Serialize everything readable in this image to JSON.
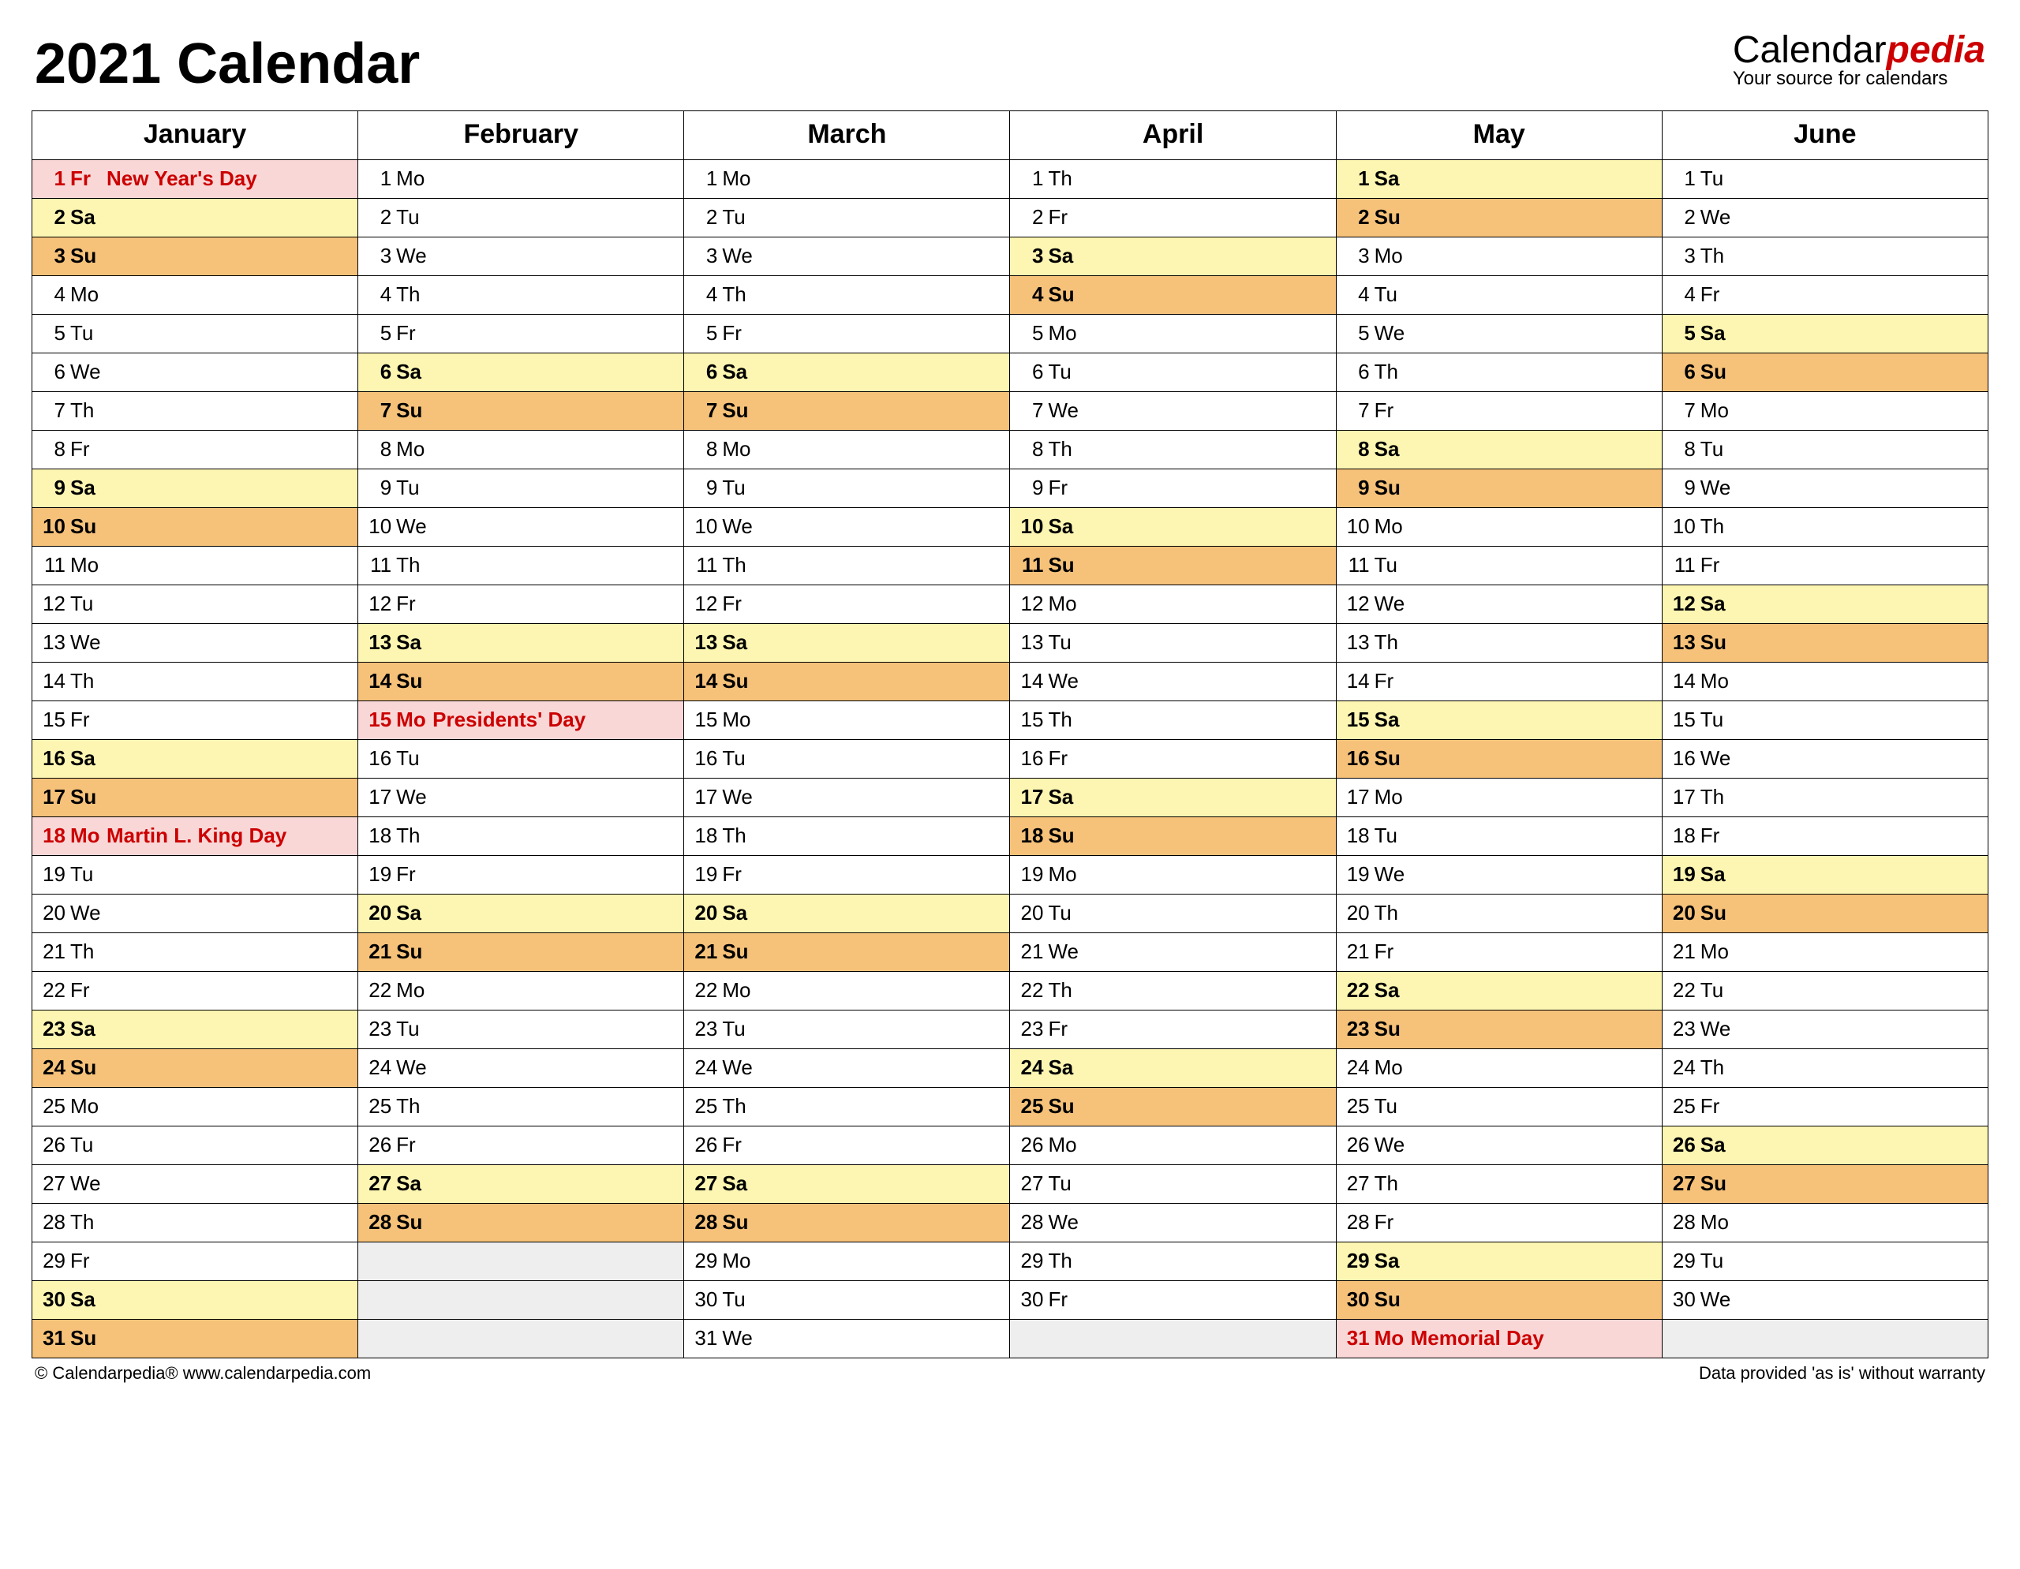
{
  "title": "2021 Calendar",
  "brand": {
    "name_a": "Calendar",
    "name_b": "pedia",
    "tagline": "Your source for calendars"
  },
  "footer_left": "© Calendarpedia®   www.calendarpedia.com",
  "footer_right": "Data provided 'as is' without warranty",
  "months": [
    "January",
    "February",
    "March",
    "April",
    "May",
    "June"
  ],
  "max_rows": 31,
  "grid": [
    [
      {
        "n": "1",
        "d": "Fr",
        "t": "hol",
        "h": "New Year's Day"
      },
      {
        "n": "2",
        "d": "Sa",
        "t": "sat"
      },
      {
        "n": "3",
        "d": "Su",
        "t": "sun"
      },
      {
        "n": "4",
        "d": "Mo",
        "t": "wd"
      },
      {
        "n": "5",
        "d": "Tu",
        "t": "wd"
      },
      {
        "n": "6",
        "d": "We",
        "t": "wd"
      },
      {
        "n": "7",
        "d": "Th",
        "t": "wd"
      },
      {
        "n": "8",
        "d": "Fr",
        "t": "wd"
      },
      {
        "n": "9",
        "d": "Sa",
        "t": "sat"
      },
      {
        "n": "10",
        "d": "Su",
        "t": "sun"
      },
      {
        "n": "11",
        "d": "Mo",
        "t": "wd"
      },
      {
        "n": "12",
        "d": "Tu",
        "t": "wd"
      },
      {
        "n": "13",
        "d": "We",
        "t": "wd"
      },
      {
        "n": "14",
        "d": "Th",
        "t": "wd"
      },
      {
        "n": "15",
        "d": "Fr",
        "t": "wd"
      },
      {
        "n": "16",
        "d": "Sa",
        "t": "sat"
      },
      {
        "n": "17",
        "d": "Su",
        "t": "sun"
      },
      {
        "n": "18",
        "d": "Mo",
        "t": "hol",
        "h": "Martin L. King Day"
      },
      {
        "n": "19",
        "d": "Tu",
        "t": "wd"
      },
      {
        "n": "20",
        "d": "We",
        "t": "wd"
      },
      {
        "n": "21",
        "d": "Th",
        "t": "wd"
      },
      {
        "n": "22",
        "d": "Fr",
        "t": "wd"
      },
      {
        "n": "23",
        "d": "Sa",
        "t": "sat"
      },
      {
        "n": "24",
        "d": "Su",
        "t": "sun"
      },
      {
        "n": "25",
        "d": "Mo",
        "t": "wd"
      },
      {
        "n": "26",
        "d": "Tu",
        "t": "wd"
      },
      {
        "n": "27",
        "d": "We",
        "t": "wd"
      },
      {
        "n": "28",
        "d": "Th",
        "t": "wd"
      },
      {
        "n": "29",
        "d": "Fr",
        "t": "wd"
      },
      {
        "n": "30",
        "d": "Sa",
        "t": "sat"
      },
      {
        "n": "31",
        "d": "Su",
        "t": "sun"
      }
    ],
    [
      {
        "n": "1",
        "d": "Mo",
        "t": "wd"
      },
      {
        "n": "2",
        "d": "Tu",
        "t": "wd"
      },
      {
        "n": "3",
        "d": "We",
        "t": "wd"
      },
      {
        "n": "4",
        "d": "Th",
        "t": "wd"
      },
      {
        "n": "5",
        "d": "Fr",
        "t": "wd"
      },
      {
        "n": "6",
        "d": "Sa",
        "t": "sat"
      },
      {
        "n": "7",
        "d": "Su",
        "t": "sun"
      },
      {
        "n": "8",
        "d": "Mo",
        "t": "wd"
      },
      {
        "n": "9",
        "d": "Tu",
        "t": "wd"
      },
      {
        "n": "10",
        "d": "We",
        "t": "wd"
      },
      {
        "n": "11",
        "d": "Th",
        "t": "wd"
      },
      {
        "n": "12",
        "d": "Fr",
        "t": "wd"
      },
      {
        "n": "13",
        "d": "Sa",
        "t": "sat"
      },
      {
        "n": "14",
        "d": "Su",
        "t": "sun"
      },
      {
        "n": "15",
        "d": "Mo",
        "t": "hol",
        "h": "Presidents' Day"
      },
      {
        "n": "16",
        "d": "Tu",
        "t": "wd"
      },
      {
        "n": "17",
        "d": "We",
        "t": "wd"
      },
      {
        "n": "18",
        "d": "Th",
        "t": "wd"
      },
      {
        "n": "19",
        "d": "Fr",
        "t": "wd"
      },
      {
        "n": "20",
        "d": "Sa",
        "t": "sat"
      },
      {
        "n": "21",
        "d": "Su",
        "t": "sun"
      },
      {
        "n": "22",
        "d": "Mo",
        "t": "wd"
      },
      {
        "n": "23",
        "d": "Tu",
        "t": "wd"
      },
      {
        "n": "24",
        "d": "We",
        "t": "wd"
      },
      {
        "n": "25",
        "d": "Th",
        "t": "wd"
      },
      {
        "n": "26",
        "d": "Fr",
        "t": "wd"
      },
      {
        "n": "27",
        "d": "Sa",
        "t": "sat"
      },
      {
        "n": "28",
        "d": "Su",
        "t": "sun"
      },
      {
        "t": "empty"
      },
      {
        "t": "empty"
      },
      {
        "t": "empty"
      }
    ],
    [
      {
        "n": "1",
        "d": "Mo",
        "t": "wd"
      },
      {
        "n": "2",
        "d": "Tu",
        "t": "wd"
      },
      {
        "n": "3",
        "d": "We",
        "t": "wd"
      },
      {
        "n": "4",
        "d": "Th",
        "t": "wd"
      },
      {
        "n": "5",
        "d": "Fr",
        "t": "wd"
      },
      {
        "n": "6",
        "d": "Sa",
        "t": "sat"
      },
      {
        "n": "7",
        "d": "Su",
        "t": "sun"
      },
      {
        "n": "8",
        "d": "Mo",
        "t": "wd"
      },
      {
        "n": "9",
        "d": "Tu",
        "t": "wd"
      },
      {
        "n": "10",
        "d": "We",
        "t": "wd"
      },
      {
        "n": "11",
        "d": "Th",
        "t": "wd"
      },
      {
        "n": "12",
        "d": "Fr",
        "t": "wd"
      },
      {
        "n": "13",
        "d": "Sa",
        "t": "sat"
      },
      {
        "n": "14",
        "d": "Su",
        "t": "sun"
      },
      {
        "n": "15",
        "d": "Mo",
        "t": "wd"
      },
      {
        "n": "16",
        "d": "Tu",
        "t": "wd"
      },
      {
        "n": "17",
        "d": "We",
        "t": "wd"
      },
      {
        "n": "18",
        "d": "Th",
        "t": "wd"
      },
      {
        "n": "19",
        "d": "Fr",
        "t": "wd"
      },
      {
        "n": "20",
        "d": "Sa",
        "t": "sat"
      },
      {
        "n": "21",
        "d": "Su",
        "t": "sun"
      },
      {
        "n": "22",
        "d": "Mo",
        "t": "wd"
      },
      {
        "n": "23",
        "d": "Tu",
        "t": "wd"
      },
      {
        "n": "24",
        "d": "We",
        "t": "wd"
      },
      {
        "n": "25",
        "d": "Th",
        "t": "wd"
      },
      {
        "n": "26",
        "d": "Fr",
        "t": "wd"
      },
      {
        "n": "27",
        "d": "Sa",
        "t": "sat"
      },
      {
        "n": "28",
        "d": "Su",
        "t": "sun"
      },
      {
        "n": "29",
        "d": "Mo",
        "t": "wd"
      },
      {
        "n": "30",
        "d": "Tu",
        "t": "wd"
      },
      {
        "n": "31",
        "d": "We",
        "t": "wd"
      }
    ],
    [
      {
        "n": "1",
        "d": "Th",
        "t": "wd"
      },
      {
        "n": "2",
        "d": "Fr",
        "t": "wd"
      },
      {
        "n": "3",
        "d": "Sa",
        "t": "sat"
      },
      {
        "n": "4",
        "d": "Su",
        "t": "sun"
      },
      {
        "n": "5",
        "d": "Mo",
        "t": "wd"
      },
      {
        "n": "6",
        "d": "Tu",
        "t": "wd"
      },
      {
        "n": "7",
        "d": "We",
        "t": "wd"
      },
      {
        "n": "8",
        "d": "Th",
        "t": "wd"
      },
      {
        "n": "9",
        "d": "Fr",
        "t": "wd"
      },
      {
        "n": "10",
        "d": "Sa",
        "t": "sat"
      },
      {
        "n": "11",
        "d": "Su",
        "t": "sun"
      },
      {
        "n": "12",
        "d": "Mo",
        "t": "wd"
      },
      {
        "n": "13",
        "d": "Tu",
        "t": "wd"
      },
      {
        "n": "14",
        "d": "We",
        "t": "wd"
      },
      {
        "n": "15",
        "d": "Th",
        "t": "wd"
      },
      {
        "n": "16",
        "d": "Fr",
        "t": "wd"
      },
      {
        "n": "17",
        "d": "Sa",
        "t": "sat"
      },
      {
        "n": "18",
        "d": "Su",
        "t": "sun"
      },
      {
        "n": "19",
        "d": "Mo",
        "t": "wd"
      },
      {
        "n": "20",
        "d": "Tu",
        "t": "wd"
      },
      {
        "n": "21",
        "d": "We",
        "t": "wd"
      },
      {
        "n": "22",
        "d": "Th",
        "t": "wd"
      },
      {
        "n": "23",
        "d": "Fr",
        "t": "wd"
      },
      {
        "n": "24",
        "d": "Sa",
        "t": "sat"
      },
      {
        "n": "25",
        "d": "Su",
        "t": "sun"
      },
      {
        "n": "26",
        "d": "Mo",
        "t": "wd"
      },
      {
        "n": "27",
        "d": "Tu",
        "t": "wd"
      },
      {
        "n": "28",
        "d": "We",
        "t": "wd"
      },
      {
        "n": "29",
        "d": "Th",
        "t": "wd"
      },
      {
        "n": "30",
        "d": "Fr",
        "t": "wd"
      },
      {
        "t": "empty"
      }
    ],
    [
      {
        "n": "1",
        "d": "Sa",
        "t": "sat"
      },
      {
        "n": "2",
        "d": "Su",
        "t": "sun"
      },
      {
        "n": "3",
        "d": "Mo",
        "t": "wd"
      },
      {
        "n": "4",
        "d": "Tu",
        "t": "wd"
      },
      {
        "n": "5",
        "d": "We",
        "t": "wd"
      },
      {
        "n": "6",
        "d": "Th",
        "t": "wd"
      },
      {
        "n": "7",
        "d": "Fr",
        "t": "wd"
      },
      {
        "n": "8",
        "d": "Sa",
        "t": "sat"
      },
      {
        "n": "9",
        "d": "Su",
        "t": "sun"
      },
      {
        "n": "10",
        "d": "Mo",
        "t": "wd"
      },
      {
        "n": "11",
        "d": "Tu",
        "t": "wd"
      },
      {
        "n": "12",
        "d": "We",
        "t": "wd"
      },
      {
        "n": "13",
        "d": "Th",
        "t": "wd"
      },
      {
        "n": "14",
        "d": "Fr",
        "t": "wd"
      },
      {
        "n": "15",
        "d": "Sa",
        "t": "sat"
      },
      {
        "n": "16",
        "d": "Su",
        "t": "sun"
      },
      {
        "n": "17",
        "d": "Mo",
        "t": "wd"
      },
      {
        "n": "18",
        "d": "Tu",
        "t": "wd"
      },
      {
        "n": "19",
        "d": "We",
        "t": "wd"
      },
      {
        "n": "20",
        "d": "Th",
        "t": "wd"
      },
      {
        "n": "21",
        "d": "Fr",
        "t": "wd"
      },
      {
        "n": "22",
        "d": "Sa",
        "t": "sat"
      },
      {
        "n": "23",
        "d": "Su",
        "t": "sun"
      },
      {
        "n": "24",
        "d": "Mo",
        "t": "wd"
      },
      {
        "n": "25",
        "d": "Tu",
        "t": "wd"
      },
      {
        "n": "26",
        "d": "We",
        "t": "wd"
      },
      {
        "n": "27",
        "d": "Th",
        "t": "wd"
      },
      {
        "n": "28",
        "d": "Fr",
        "t": "wd"
      },
      {
        "n": "29",
        "d": "Sa",
        "t": "sat"
      },
      {
        "n": "30",
        "d": "Su",
        "t": "sun"
      },
      {
        "n": "31",
        "d": "Mo",
        "t": "hol",
        "h": "Memorial Day"
      }
    ],
    [
      {
        "n": "1",
        "d": "Tu",
        "t": "wd"
      },
      {
        "n": "2",
        "d": "We",
        "t": "wd"
      },
      {
        "n": "3",
        "d": "Th",
        "t": "wd"
      },
      {
        "n": "4",
        "d": "Fr",
        "t": "wd"
      },
      {
        "n": "5",
        "d": "Sa",
        "t": "sat"
      },
      {
        "n": "6",
        "d": "Su",
        "t": "sun"
      },
      {
        "n": "7",
        "d": "Mo",
        "t": "wd"
      },
      {
        "n": "8",
        "d": "Tu",
        "t": "wd"
      },
      {
        "n": "9",
        "d": "We",
        "t": "wd"
      },
      {
        "n": "10",
        "d": "Th",
        "t": "wd"
      },
      {
        "n": "11",
        "d": "Fr",
        "t": "wd"
      },
      {
        "n": "12",
        "d": "Sa",
        "t": "sat"
      },
      {
        "n": "13",
        "d": "Su",
        "t": "sun"
      },
      {
        "n": "14",
        "d": "Mo",
        "t": "wd"
      },
      {
        "n": "15",
        "d": "Tu",
        "t": "wd"
      },
      {
        "n": "16",
        "d": "We",
        "t": "wd"
      },
      {
        "n": "17",
        "d": "Th",
        "t": "wd"
      },
      {
        "n": "18",
        "d": "Fr",
        "t": "wd"
      },
      {
        "n": "19",
        "d": "Sa",
        "t": "sat"
      },
      {
        "n": "20",
        "d": "Su",
        "t": "sun"
      },
      {
        "n": "21",
        "d": "Mo",
        "t": "wd"
      },
      {
        "n": "22",
        "d": "Tu",
        "t": "wd"
      },
      {
        "n": "23",
        "d": "We",
        "t": "wd"
      },
      {
        "n": "24",
        "d": "Th",
        "t": "wd"
      },
      {
        "n": "25",
        "d": "Fr",
        "t": "wd"
      },
      {
        "n": "26",
        "d": "Sa",
        "t": "sat"
      },
      {
        "n": "27",
        "d": "Su",
        "t": "sun"
      },
      {
        "n": "28",
        "d": "Mo",
        "t": "wd"
      },
      {
        "n": "29",
        "d": "Tu",
        "t": "wd"
      },
      {
        "n": "30",
        "d": "We",
        "t": "wd"
      },
      {
        "t": "empty"
      }
    ]
  ]
}
